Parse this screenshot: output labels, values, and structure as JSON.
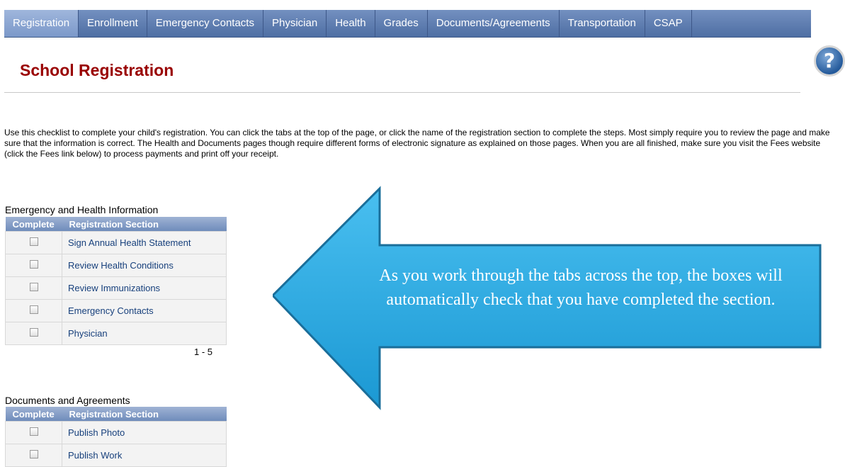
{
  "tabs": [
    {
      "label": "Registration"
    },
    {
      "label": "Enrollment"
    },
    {
      "label": "Emergency Contacts"
    },
    {
      "label": "Physician"
    },
    {
      "label": "Health"
    },
    {
      "label": "Grades"
    },
    {
      "label": "Documents/Agreements"
    },
    {
      "label": "Transportation"
    },
    {
      "label": "CSAP"
    }
  ],
  "page": {
    "title": "School Registration",
    "help_icon": "question-mark-icon",
    "intro": "Use this checklist to complete your child's registration. You can click the tabs at the top of the page, or click the name of the registration section to complete the steps. Most simply require you to review the page and make sure that the information is correct. The Health and Documents pages though require different forms of electronic signature as explained on those pages. When you are all finished, make sure you visit the Fees website (click the Fees link below) to process payments and print off your receipt."
  },
  "health": {
    "title": "Emergency and Health Information",
    "col1": "Complete",
    "col2": "Registration Section",
    "rows": [
      {
        "label": "Sign Annual Health Statement"
      },
      {
        "label": "Review Health Conditions"
      },
      {
        "label": "Review Immunizations"
      },
      {
        "label": "Emergency Contacts"
      },
      {
        "label": "Physician"
      }
    ],
    "pager": "1 - 5"
  },
  "docs": {
    "title": "Documents and Agreements",
    "col1": "Complete",
    "col2": "Registration Section",
    "rows": [
      {
        "label": "Publish Photo"
      },
      {
        "label": "Publish Work"
      }
    ]
  },
  "callout": {
    "text": "As you work through the tabs across the top, the boxes will automatically check that you have completed the section.",
    "color": "#2aa8df"
  }
}
